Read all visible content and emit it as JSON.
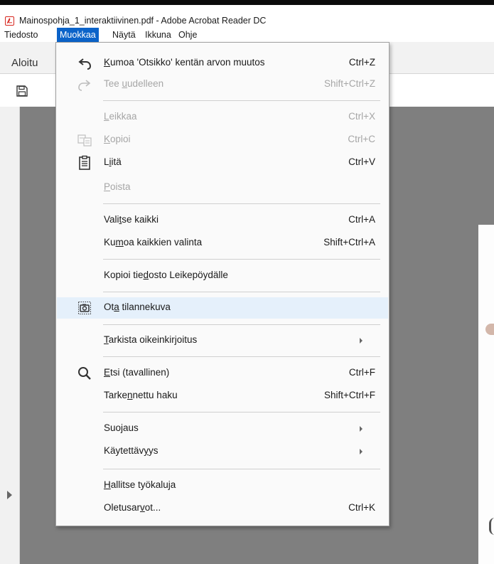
{
  "window": {
    "title": "Mainospohja_1_interaktiivinen.pdf - Adobe Acrobat Reader DC"
  },
  "menubar": {
    "items": [
      "Tiedosto",
      "Muokkaa",
      "Näytä",
      "Ikkuna",
      "Ohje"
    ],
    "active": "Muokkaa"
  },
  "toolbar": {
    "home_tab": "Aloitu"
  },
  "menu": {
    "undo": {
      "pre": "",
      "u": "K",
      "post": "umoa 'Otsikko' kentän arvon muutos",
      "shortcut": "Ctrl+Z"
    },
    "redo": {
      "pre": "Tee ",
      "u": "u",
      "post": "udelleen",
      "shortcut": "Shift+Ctrl+Z"
    },
    "cut": {
      "pre": "",
      "u": "L",
      "post": "eikkaa",
      "shortcut": "Ctrl+X"
    },
    "copy": {
      "pre": "",
      "u": "K",
      "post": "opioi",
      "shortcut": "Ctrl+C"
    },
    "paste": {
      "pre": "L",
      "u": "i",
      "post": "itä",
      "shortcut": "Ctrl+V"
    },
    "delete": {
      "pre": "",
      "u": "P",
      "post": "oista",
      "shortcut": ""
    },
    "select_all": {
      "pre": "Vali",
      "u": "t",
      "post": "se kaikki",
      "shortcut": "Ctrl+A"
    },
    "deselect_all": {
      "pre": "Ku",
      "u": "m",
      "post": "oa kaikkien valinta",
      "shortcut": "Shift+Ctrl+A"
    },
    "copy_file": {
      "pre": "Kopioi tie",
      "u": "d",
      "post": "osto Leikepöydälle",
      "shortcut": ""
    },
    "snapshot": {
      "pre": "Ot",
      "u": "a",
      "post": " tilannekuva",
      "shortcut": ""
    },
    "spellcheck": {
      "pre": "",
      "u": "T",
      "post": "arkista oikeinkirjoitus",
      "shortcut": ""
    },
    "find": {
      "pre": "",
      "u": "E",
      "post": "tsi (tavallinen)",
      "shortcut": "Ctrl+F"
    },
    "advanced_search": {
      "pre": "Tarke",
      "u": "n",
      "post": "nettu haku",
      "shortcut": "Shift+Ctrl+F"
    },
    "protection": {
      "pre": "Suo",
      "u": "j",
      "post": "aus",
      "shortcut": ""
    },
    "accessibility": {
      "pre": "Käytettäv",
      "u": "y",
      "post": "ys",
      "shortcut": ""
    },
    "manage_tools": {
      "pre": "",
      "u": "H",
      "post": "allitse työkaluja",
      "shortcut": ""
    },
    "preferences": {
      "pre": "Oletusar",
      "u": "v",
      "post": "ot...",
      "shortcut": "Ctrl+K"
    }
  },
  "colors": {
    "menu_active_bg": "#0b63c9",
    "hover_bg": "#e5f0fb",
    "disabled_text": "#a6a6a6",
    "doc_bg": "#7f7f7f"
  }
}
